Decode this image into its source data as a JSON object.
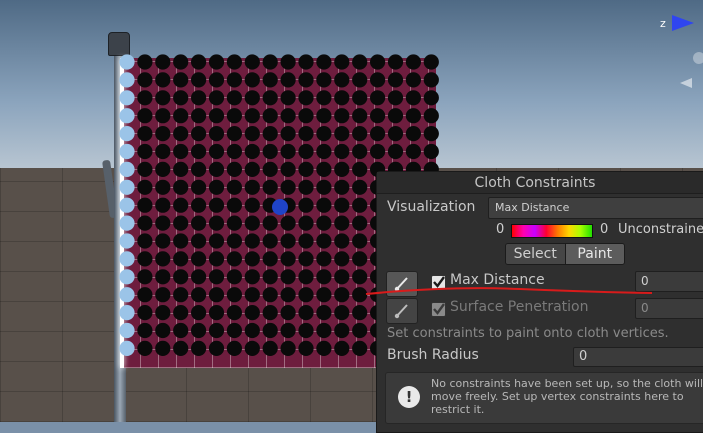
{
  "scene": {
    "gizmo_axis_label": "z"
  },
  "panel": {
    "title": "Cloth Constraints",
    "visualization_label": "Visualization",
    "visualization_value": "Max Distance",
    "gradient_min": "0",
    "gradient_max": "0",
    "gradient_unconstrained": "Unconstrained",
    "mode_select": "Select",
    "mode_paint": "Paint",
    "mode_selected": "Paint",
    "max_distance": {
      "label": "Max Distance",
      "checked": true,
      "value": "0"
    },
    "surface_penetration": {
      "label": "Surface Penetration",
      "checked": true,
      "enabled": false,
      "value": "0"
    },
    "hint": "Set constraints to paint onto cloth vertices.",
    "brush_radius_label": "Brush Radius",
    "brush_radius_value": "0",
    "help_text": "No constraints have been set up, so the cloth will move freely. Set up vertex constraints here to restrict it.",
    "help_icon": "exclamation-icon"
  },
  "colors": {
    "cloth": "#6e1d3e",
    "panel_bg": "#2f2f2f",
    "underline": "#d81b1b",
    "gizmo_z": "#2f45f0"
  }
}
